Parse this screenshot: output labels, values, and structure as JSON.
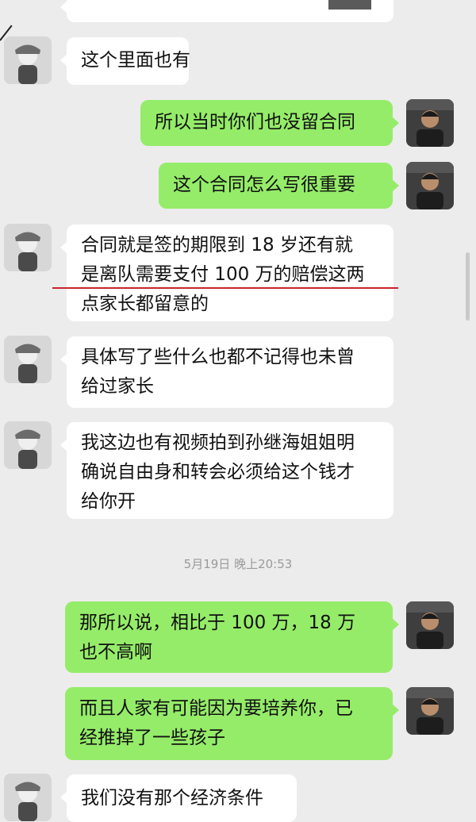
{
  "colors": {
    "background": "#ececec",
    "incoming_bubble": "#ffffff",
    "outgoing_bubble": "#95ec69",
    "annotation_underline": "#c8242b",
    "timestamp_text": "#9a9a9a"
  },
  "icons": {
    "contact_avatar": "contact-avatar-icon",
    "self_avatar": "self-avatar-icon"
  },
  "messages": [
    {
      "sender": "contact",
      "lines": [
        "这个里面也有"
      ]
    },
    {
      "sender": "self",
      "lines": [
        "所以当时你们也没留合同"
      ]
    },
    {
      "sender": "self",
      "lines": [
        "这个合同怎么写很重要"
      ]
    },
    {
      "sender": "contact",
      "lines": [
        "合同就是签的期限到 18 岁还有就",
        "是离队需要支付 100 万的赔偿这两",
        "点家长都留意的"
      ]
    },
    {
      "sender": "contact",
      "lines": [
        "具体写了些什么也都不记得也未曾",
        "给过家长"
      ]
    },
    {
      "sender": "contact",
      "lines": [
        "我这边也有视频拍到孙继海姐姐明",
        "确说自由身和转会必须给这个钱才",
        "给你开"
      ]
    },
    {
      "sender": "self",
      "lines": [
        "那所以说，相比于 100 万，18 万",
        "也不高啊"
      ]
    },
    {
      "sender": "self",
      "lines": [
        "而且人家有可能因为要培养你，已",
        "经推掉了一些孩子"
      ]
    },
    {
      "sender": "contact",
      "lines": [
        "我们没有那个经济条件"
      ]
    }
  ],
  "timestamp": "5月19日 晚上20:53"
}
